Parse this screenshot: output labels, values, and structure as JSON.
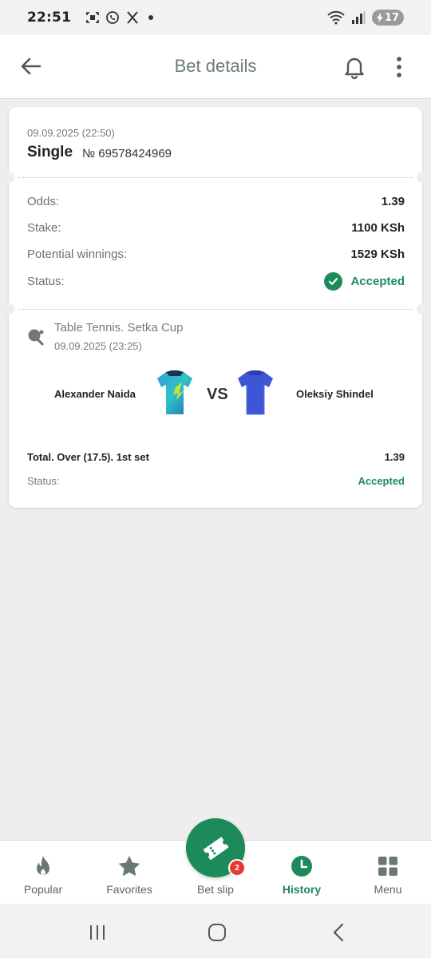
{
  "status_bar": {
    "time": "22:51",
    "battery": "17",
    "icons": [
      "screenshot-icon",
      "whatsapp-icon",
      "x-icon",
      "dot-icon",
      "wifi-icon",
      "signal-icon",
      "battery-icon"
    ]
  },
  "app_bar": {
    "title": "Bet details",
    "icons": [
      "back-arrow-icon",
      "bell-icon",
      "more-vertical-icon"
    ]
  },
  "bet": {
    "date": "09.09.2025 (22:50)",
    "type": "Single",
    "number": "№ 69578424969",
    "odds_label": "Odds:",
    "odds_value": "1.39",
    "stake_label": "Stake:",
    "stake_value": "1100 KSh",
    "winnings_label": "Potential winnings:",
    "winnings_value": "1529 KSh",
    "status_label": "Status:",
    "status_value": "Accepted"
  },
  "event": {
    "sport_title": "Table Tennis. Setka Cup",
    "date": "09.09.2025 (23:25)",
    "team1": "Alexander Naida",
    "vs": "VS",
    "team2": "Oleksiy Shindel",
    "market": "Total. Over (17.5). 1st set",
    "market_odds": "1.39",
    "status_label": "Status:",
    "status_value": "Accepted"
  },
  "bottom_nav": {
    "items": [
      {
        "label": "Popular",
        "icon": "flame-icon"
      },
      {
        "label": "Favorites",
        "icon": "star-icon"
      },
      {
        "label": "Bet slip",
        "icon": "ticket-icon",
        "badge": "2"
      },
      {
        "label": "History",
        "icon": "clock-icon",
        "active": true
      },
      {
        "label": "Menu",
        "icon": "grid-icon"
      }
    ]
  },
  "colors": {
    "accent": "#1d8a5c",
    "badge": "#e53935",
    "background": "#eeeeee"
  }
}
